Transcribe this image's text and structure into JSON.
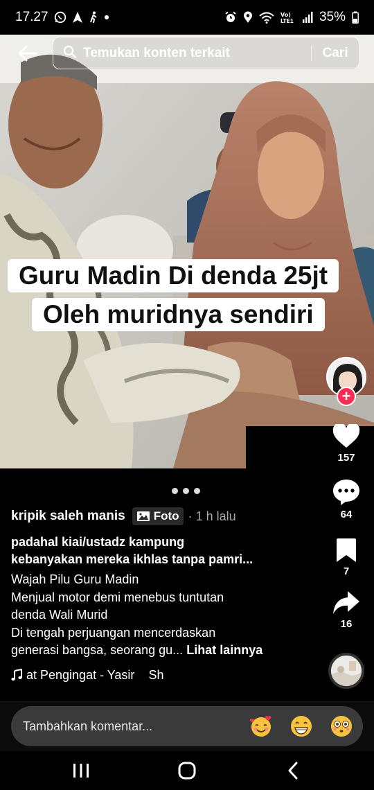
{
  "status_bar": {
    "time": "17.27",
    "battery": "35%",
    "icons_left": [
      "whatsapp-icon",
      "navigation-icon",
      "walking-icon",
      "dot-icon"
    ],
    "icons_right": [
      "alarm-icon",
      "location-icon",
      "wifi-icon",
      "volte-icon",
      "signal-icon",
      "battery-icon"
    ]
  },
  "search": {
    "placeholder": "Temukan konten terkait",
    "button_label": "Cari"
  },
  "video": {
    "caption_line1": "Guru Madin Di denda 25jt",
    "caption_line2": "Oleh muridnya sendiri"
  },
  "actions": {
    "likes": "157",
    "comments": "64",
    "saves": "7",
    "shares": "16",
    "like_color": "#ffffff",
    "follow_color": "#fe2c55"
  },
  "post": {
    "author": "kripik saleh manis",
    "badge": "Foto",
    "time": "· 1 h lalu",
    "title_line1": "padahal kiai/ustadz kampung",
    "title_line2": "kebanyakan mereka ikhlas tanpa pamri...",
    "desc_line1": "Wajah Pilu Guru Madin",
    "desc_line2": "Menjual motor demi menebus tuntutan",
    "desc_line3": "denda Wali Murid",
    "desc_line4": "Di tengah perjuangan mencerdaskan",
    "desc_line5": "generasi bangsa, seorang gu...",
    "see_more": "Lihat lainnya"
  },
  "music": {
    "title": "at Pengingat - Yasir",
    "tail": "Sh"
  },
  "comment": {
    "placeholder": "Tambahkan komentar..."
  }
}
